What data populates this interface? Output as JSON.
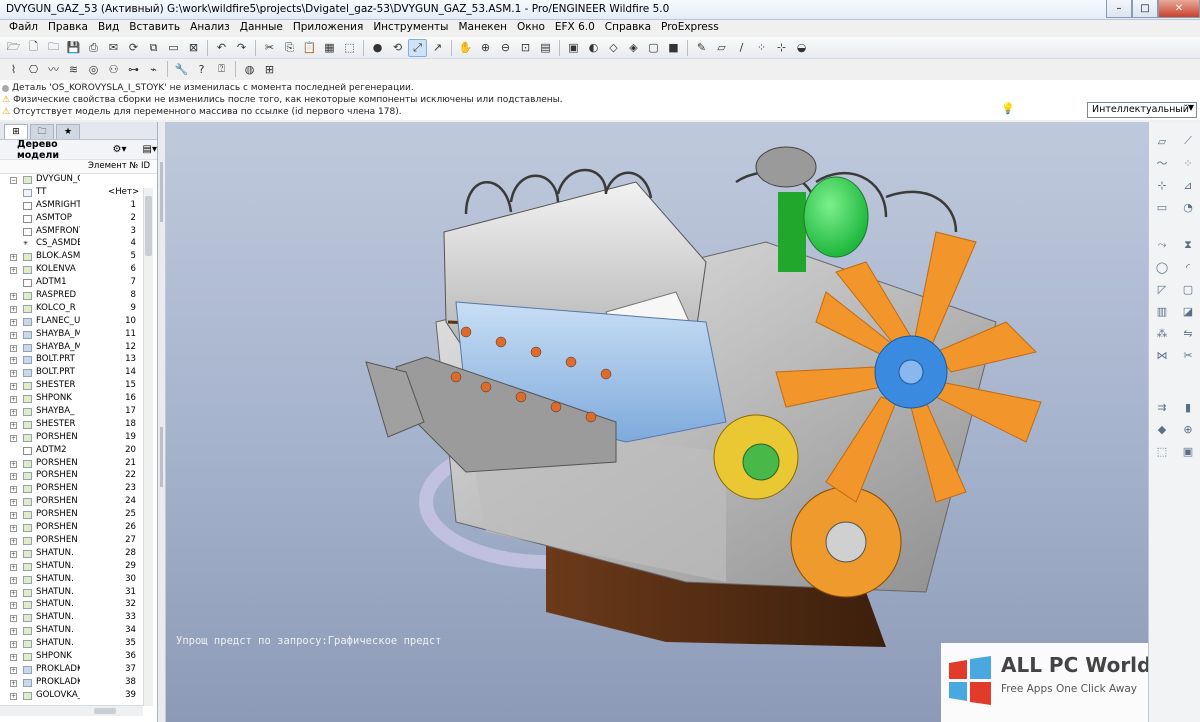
{
  "window": {
    "title": "DVYGUN_GAZ_53 (Активный) G:\\work\\wildfire5\\projects\\Dvigatel_gaz-53\\DVYGUN_GAZ_53.ASM.1 - Pro/ENGINEER Wildfire 5.0",
    "min": "–",
    "max": "□",
    "close": "✕"
  },
  "menu": [
    "Файл",
    "Правка",
    "Вид",
    "Вставить",
    "Анализ",
    "Данные",
    "Приложения",
    "Инструменты",
    "Манекен",
    "Окно",
    "EFX 6.0",
    "Справка",
    "ProExpress"
  ],
  "toolbar": {
    "row1": [
      "folder-icon",
      "new-file-icon",
      "open-icon",
      "save-icon",
      "print-icon",
      "email-icon",
      "regenerate-icon",
      "copy-icon",
      "window-icon",
      "close-window-icon",
      "undo-icon",
      "redo-icon",
      "cut-icon",
      "copy2-icon",
      "paste-icon",
      "paste-special-icon",
      "select-icon",
      "sphere-icon",
      "spin-icon",
      "orient-icon",
      "datum-axis-icon",
      "pan-icon",
      "zoom-in-icon",
      "zoom-out-icon",
      "refit-icon",
      "layers-icon",
      "view-manager-icon",
      "shading-icon",
      "wireframe-icon",
      "hidden-line-icon",
      "no-hidden-icon",
      "shaded-icon",
      "sketch-icon",
      "plane-display-icon",
      "axis-display-icon",
      "point-display-icon",
      "csys-display-icon",
      "render-icon"
    ],
    "row2": [
      "pipe-icon",
      "routing-icon",
      "cable-icon",
      "harness-icon",
      "spool-icon",
      "connector-icon",
      "network-icon",
      "wire-icon",
      "wrench-icon",
      "help-query-icon",
      "help-icon",
      "globe-icon",
      "tree-filter-icon"
    ]
  },
  "messages": [
    "Деталь 'OS_KOROVYSLA_I_STOYK' не изменилась с момента последней регенерации.",
    "Физические свойства сборки не изменились после того, как некоторые компоненты исключены или подставлены.",
    "Отсутствует модель для переменного массива по ссылке (id первого члена 178)."
  ],
  "filter": {
    "value": "Интеллектуальный"
  },
  "model_tree": {
    "title": "Дерево модели",
    "col_element": "Элемент №",
    "col_id": "ID",
    "items": [
      {
        "name": "DVYGUN_GAZ_",
        "el": "",
        "id": "",
        "type": "asm"
      },
      {
        "name": "TT",
        "el": "<Нет>",
        "id": "",
        "type": "note"
      },
      {
        "name": "ASMRIGHT",
        "el": "1",
        "id": "",
        "type": "datum"
      },
      {
        "name": "ASMTOP",
        "el": "2",
        "id": "",
        "type": "datum"
      },
      {
        "name": "ASMFRONT",
        "el": "3",
        "id": "",
        "type": "datum"
      },
      {
        "name": "CS_ASMDE",
        "el": "4",
        "id": "",
        "type": "csys"
      },
      {
        "name": "BLOK.ASM",
        "el": "5",
        "id": "",
        "type": "asm"
      },
      {
        "name": "KOLENVA",
        "el": "6",
        "id": "",
        "type": "asm"
      },
      {
        "name": "ADTM1",
        "el": "7",
        "id": "",
        "type": "datum"
      },
      {
        "name": "RASPRED",
        "el": "8",
        "id": "",
        "type": "asm"
      },
      {
        "name": "KOLCO_R",
        "el": "9",
        "id": "",
        "type": "asm"
      },
      {
        "name": "FLANEC_U",
        "el": "10",
        "id": "",
        "type": "prt"
      },
      {
        "name": "SHAYBA_M",
        "el": "11",
        "id": "",
        "type": "prt"
      },
      {
        "name": "SHAYBA_M",
        "el": "12",
        "id": "",
        "type": "prt"
      },
      {
        "name": "BOLT.PRT",
        "el": "13",
        "id": "",
        "type": "prt"
      },
      {
        "name": "BOLT.PRT",
        "el": "14",
        "id": "",
        "type": "prt"
      },
      {
        "name": "SHESTER",
        "el": "15",
        "id": "",
        "type": "asm"
      },
      {
        "name": "SHPONK",
        "el": "16",
        "id": "",
        "type": "asm"
      },
      {
        "name": "SHAYBA_",
        "el": "17",
        "id": "",
        "type": "asm"
      },
      {
        "name": "SHESTER",
        "el": "18",
        "id": "",
        "type": "asm"
      },
      {
        "name": "PORSHEN",
        "el": "19",
        "id": "",
        "type": "asm"
      },
      {
        "name": "ADTM2",
        "el": "20",
        "id": "",
        "type": "datum"
      },
      {
        "name": "PORSHEN",
        "el": "21",
        "id": "",
        "type": "asm"
      },
      {
        "name": "PORSHEN",
        "el": "22",
        "id": "",
        "type": "asm"
      },
      {
        "name": "PORSHEN",
        "el": "23",
        "id": "",
        "type": "asm"
      },
      {
        "name": "PORSHEN",
        "el": "24",
        "id": "",
        "type": "asm"
      },
      {
        "name": "PORSHEN",
        "el": "25",
        "id": "",
        "type": "asm"
      },
      {
        "name": "PORSHEN",
        "el": "26",
        "id": "",
        "type": "asm"
      },
      {
        "name": "PORSHEN",
        "el": "27",
        "id": "",
        "type": "asm"
      },
      {
        "name": "SHATUN.",
        "el": "28",
        "id": "",
        "type": "asm"
      },
      {
        "name": "SHATUN.",
        "el": "29",
        "id": "",
        "type": "asm"
      },
      {
        "name": "SHATUN.",
        "el": "30",
        "id": "",
        "type": "asm"
      },
      {
        "name": "SHATUN.",
        "el": "31",
        "id": "",
        "type": "asm"
      },
      {
        "name": "SHATUN.",
        "el": "32",
        "id": "",
        "type": "asm"
      },
      {
        "name": "SHATUN.",
        "el": "33",
        "id": "",
        "type": "asm"
      },
      {
        "name": "SHATUN.",
        "el": "34",
        "id": "",
        "type": "asm"
      },
      {
        "name": "SHATUN.",
        "el": "35",
        "id": "",
        "type": "asm"
      },
      {
        "name": "SHPONK",
        "el": "36",
        "id": "",
        "type": "asm"
      },
      {
        "name": "PROKLADK",
        "el": "37",
        "id": "",
        "type": "prt"
      },
      {
        "name": "PROKLADK",
        "el": "38",
        "id": "",
        "type": "prt"
      },
      {
        "name": "GOLOVKA_",
        "el": "39",
        "id": "",
        "type": "asm"
      }
    ]
  },
  "viewport": {
    "status_text": "Упрощ предст по запросу:Графическое предст",
    "colors": {
      "bg_top": "#bfc9dc",
      "bg_bottom": "#8d9ab7",
      "fan": "#f0952a",
      "hub": "#3a8ae0",
      "cover": "#9fc3e8",
      "tank": "#2ed84a",
      "pan": "#5a2f14"
    }
  },
  "watermark": {
    "title": "ALL PC World",
    "subtitle": "Free Apps One Click Away"
  },
  "right_toolbar": [
    "datum-plane-icon",
    "datum-axis-icon",
    "sketch-curve-icon",
    "datum-point-icon",
    "csys-icon",
    "analysis-icon",
    "extrude-icon",
    "revolve-icon",
    "sweep-icon",
    "blend-icon",
    "hole-icon",
    "round-icon",
    "chamfer-icon",
    "shell-icon",
    "rib-icon",
    "draft-icon",
    "pattern-icon",
    "mirror-icon",
    "merge-icon",
    "trim-icon",
    "offset-icon",
    "thicken-icon",
    "solidify-icon",
    "assemble-icon",
    "create-component-icon",
    "package-icon"
  ]
}
